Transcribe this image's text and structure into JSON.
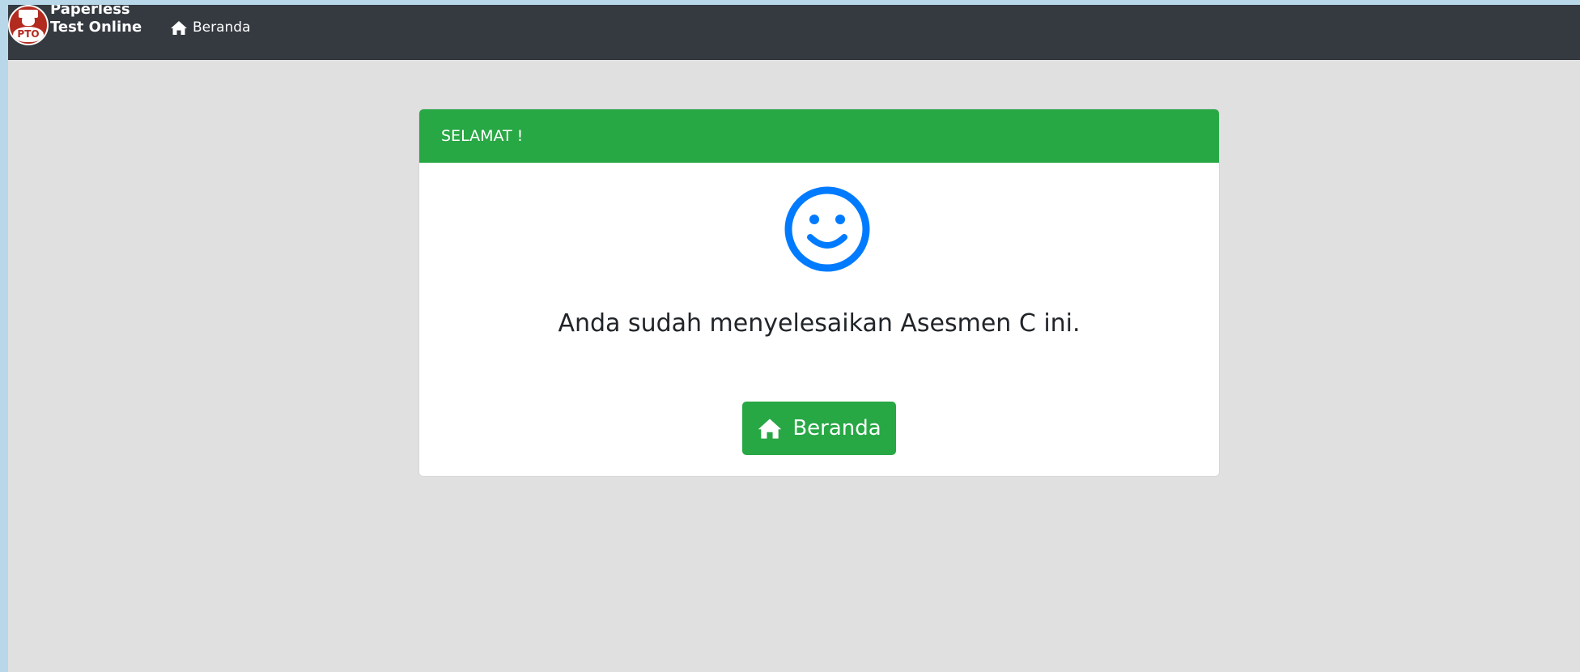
{
  "navbar": {
    "brand_line1": "Paperless",
    "brand_line2": "Test Online",
    "logo_text": "PTO",
    "nav_home_label": "Beranda",
    "nav_home_icon": "home-icon"
  },
  "card": {
    "header_title": "SELAMAT !",
    "status_icon": "smiley-icon",
    "message": "Anda sudah menyelesaikan Asesmen C ini.",
    "button_label": "Beranda",
    "button_icon": "home-icon"
  },
  "colors": {
    "navbar_bg": "#343a40",
    "page_bg": "#e0e0e0",
    "success": "#28a745",
    "smiley": "#007bff",
    "logo": "#b32a1f"
  }
}
